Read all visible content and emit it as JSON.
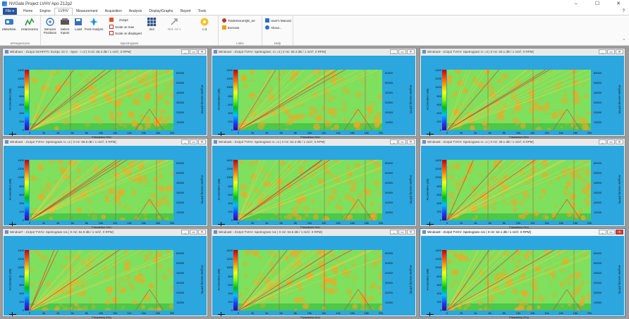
{
  "app": {
    "title": "NVGate Project LVHV Apo Z12p2",
    "controls": {
      "minimize": "–",
      "maximize": "☐",
      "close": "✕"
    }
  },
  "ribbon": {
    "file_label": "File ▾",
    "tabs": [
      "Home",
      "Engine",
      "LV/HV",
      "Measurement",
      "Acquisition",
      "Analysis",
      "Display/Graphs",
      "Report",
      "Tools"
    ],
    "active_tab": "LV/HV",
    "help": "?",
    "collapse": "^",
    "groups": {
      "efrequencies": {
        "label": "eFrequencies",
        "buttons": [
          {
            "label": "eMachine",
            "icon": "machine-icon"
          },
          {
            "label": "eHarmonics",
            "icon": "harmonics-icon"
          }
        ]
      },
      "spectrogram": {
        "label": "Spectrogram",
        "buttons": [
          {
            "label": "Sensors Positions",
            "icon": "sensors-icon"
          },
          {
            "label": "Select Inputs",
            "icon": "inputs-icon"
          },
          {
            "label": "Load",
            "icon": "load-icon"
          },
          {
            "label": "Post-Analyze",
            "icon": "post-analyze-icon"
          }
        ],
        "small": [
          {
            "label": "Z12p2",
            "icon": "file-icon"
          },
          {
            "label": "Scale on max",
            "icon": "scale-max-icon"
          },
          {
            "label": "Scale on displayed",
            "icon": "scale-displayed-icon"
          }
        ],
        "layout": {
          "label": "3x3",
          "icon": "grid-layout-icon"
        },
        "ref_rot": {
          "label": "Ref. rot 1",
          "icon": "ref-rot-icon"
        },
        "order": {
          "label": "r=3",
          "icon": "order-icon"
        }
      },
      "links": {
        "label": "Links",
        "items": [
          {
            "label": "TrainHierumQE_ee",
            "icon": "link-icon"
          },
          {
            "label": "Execute",
            "icon": "execute-icon"
          }
        ]
      },
      "help": {
        "label": "Help",
        "items": [
          {
            "label": "User's Manual",
            "icon": "manual-icon"
          },
          {
            "label": "About...",
            "icon": "info-icon"
          }
        ]
      }
    }
  },
  "axes": {
    "y_left_label": "Acceleration (dB)",
    "y_left_ticks": [
      "1400",
      "1200",
      "1000",
      "800",
      "600",
      "400",
      "200",
      "0"
    ],
    "y_right_label": "Angular velocity (RPM)",
    "y_right_ticks": [
      "60000",
      "50000",
      "40000",
      "30000",
      "20000",
      "10000"
    ],
    "x_label": "Frequency (Hz)",
    "x_ticks": [
      "0",
      "2k",
      "4k",
      "6k",
      "8k",
      "10k",
      "12k",
      "14k",
      "16k",
      "18k",
      "20k"
    ]
  },
  "windows": [
    {
      "title": "Window1 - Z12p2 NVHFFTI: lnxSpc 10 V · Spec · r=3 | 0 Hz: 68.4 dB / 1 m/s², 0 RPM]",
      "active": false
    },
    {
      "title": "Window2 - Z12p2 TVHV: Spetrogram: ro =3 | 0 Hz: 58.3 dB / 1 m/s², 0 RPM]",
      "active": false
    },
    {
      "title": "Window3 - Z12p2 TVHV: Spetrogram ro =3 | 0 Hz: 60.1 dB / 1 m/s², 0 RPM]",
      "active": false
    },
    {
      "title": "Window4 - Z12p2 TVHV: Spetrogram ro =2 | 0 Hz: 58.8 dB / 1 m/s², 0 RPM]",
      "active": false
    },
    {
      "title": "Window5 - Z12p2 TVHV: Spetrogram ro =2 | 0 Hz: 54.3 dB / 1 m/s², 0 RPM]",
      "active": false
    },
    {
      "title": "Window6 - Z12p2 TVHV: Spetrogram ro =1 | 0 Hz: 49.1 dB / 1 m/s², 0 RPM]",
      "active": false
    },
    {
      "title": "Window7 - Z12p2 TVHV: Spetrogram ro1 | 0 Hz: 54.9 dB / 1 m/s², 0 RPM]",
      "active": false
    },
    {
      "title": "Window8 - Z12p2 TVHV: Spetrogram ro1 | 0 Hz: 63.6 dB / 1 m/s², 0 RPM]",
      "active": false
    },
    {
      "title": "Window9 - Z12p2 TVHV: Spetrogram ro1 | 0 Hz: 62.1 dB / 1 m/s², 0 RPM]",
      "active": true
    }
  ],
  "window_buttons": {
    "minimize": "_",
    "restore": "▭",
    "close": "✕"
  },
  "colors": {
    "plot_background": "#2ba6df",
    "ribbon_file": "#2b579a",
    "spectro_base": "#7ee05c",
    "spectro_hot": "#f5a623",
    "spectro_line": "#d83a2a"
  }
}
